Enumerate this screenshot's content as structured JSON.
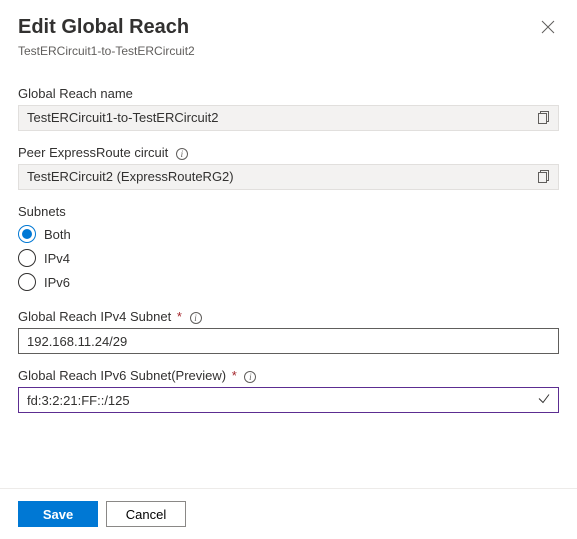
{
  "header": {
    "title": "Edit Global Reach",
    "subtitle": "TestERCircuit1-to-TestERCircuit2"
  },
  "fields": {
    "name_label": "Global Reach name",
    "name_value": "TestERCircuit1-to-TestERCircuit2",
    "peer_label": "Peer ExpressRoute circuit",
    "peer_value": "TestERCircuit2 (ExpressRouteRG2)",
    "subnets_label": "Subnets",
    "subnets_options": {
      "opt0": "Both",
      "opt1": "IPv4",
      "opt2": "IPv6"
    },
    "subnets_selected": "Both",
    "ipv4_label": "Global Reach IPv4 Subnet",
    "ipv4_value": "192.168.11.24/29",
    "ipv6_label": "Global Reach IPv6 Subnet(Preview)",
    "ipv6_value": "fd:3:2:21:FF::/125"
  },
  "footer": {
    "save_label": "Save",
    "cancel_label": "Cancel"
  }
}
